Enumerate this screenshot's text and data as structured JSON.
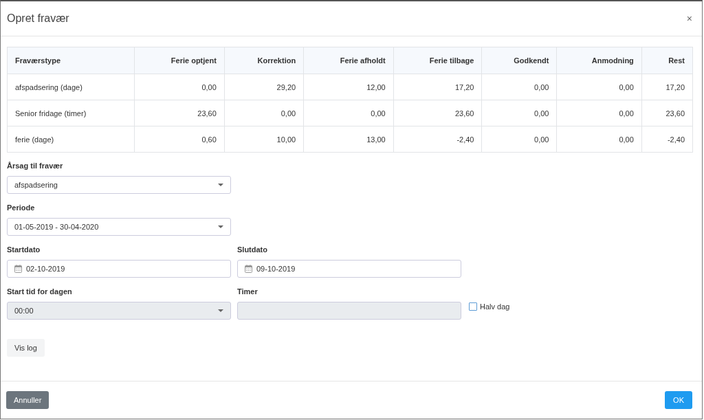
{
  "dialog": {
    "title": "Opret fravær",
    "close": "×"
  },
  "table": {
    "columns": [
      "Fraværstype",
      "Ferie optjent",
      "Korrektion",
      "Ferie afholdt",
      "Ferie tilbage",
      "Godkendt",
      "Anmodning",
      "Rest"
    ],
    "rows": [
      [
        "afspadsering (dage)",
        "0,00",
        "29,20",
        "12,00",
        "17,20",
        "0,00",
        "0,00",
        "17,20"
      ],
      [
        "Senior fridage (timer)",
        "23,60",
        "0,00",
        "0,00",
        "23,60",
        "0,00",
        "0,00",
        "23,60"
      ],
      [
        "ferie (dage)",
        "0,60",
        "10,00",
        "13,00",
        "-2,40",
        "0,00",
        "0,00",
        "-2,40"
      ]
    ]
  },
  "form": [
    [
      {
        "kind": "select",
        "label": "Årsag til fravær",
        "value": "afspadsering",
        "disabled": false
      }
    ],
    [
      {
        "kind": "select",
        "label": "Periode",
        "value": "01-05-2019 - 30-04-2020",
        "disabled": false
      }
    ],
    [
      {
        "kind": "date",
        "label": "Startdato",
        "value": "02-10-2019",
        "disabled": false
      },
      {
        "kind": "date",
        "label": "Slutdato",
        "value": "09-10-2019",
        "disabled": false
      }
    ],
    [
      {
        "kind": "select",
        "label": "Start tid for dagen",
        "value": "00:00",
        "disabled": true
      },
      {
        "kind": "text",
        "label": "Timer",
        "disabled": true
      },
      {
        "kind": "checkbox",
        "label": "Halv dag",
        "checked": false
      }
    ]
  ],
  "log_button": "Vis log",
  "footer": [
    {
      "label": "Annuller",
      "kind": "secondary"
    },
    {
      "label": "OK",
      "kind": "primary"
    }
  ]
}
